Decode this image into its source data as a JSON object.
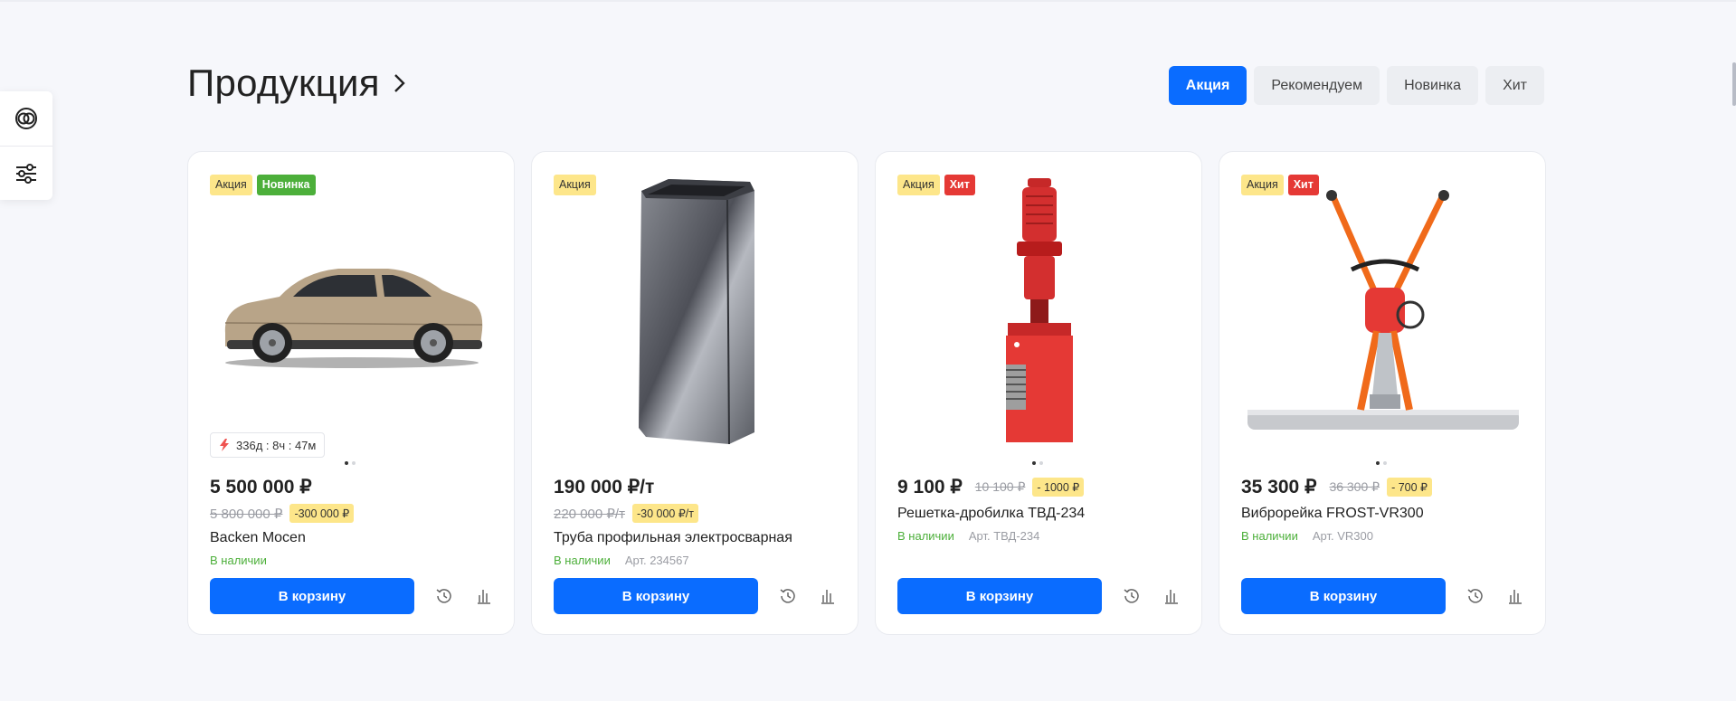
{
  "header": {
    "title": "Продукция"
  },
  "tabs": [
    {
      "label": "Акция",
      "active": true
    },
    {
      "label": "Рекомендуем",
      "active": false
    },
    {
      "label": "Новинка",
      "active": false
    },
    {
      "label": "Хит",
      "active": false
    }
  ],
  "side_panel": {
    "items": [
      "compare-circles-icon",
      "filter-sliders-icon"
    ]
  },
  "colors": {
    "accent": "#0a6cff",
    "promo_badge": "#fde68a",
    "new_badge": "#4caf3a",
    "hit_badge": "#e53935",
    "in_stock": "#4caf3a"
  },
  "products": [
    {
      "badges": [
        "Акция",
        "Новинка"
      ],
      "image": "car",
      "timer": "336д : 8ч : 47м",
      "price": "5 500 000 ₽",
      "old_price": "5 800 000 ₽",
      "discount": "-300 000 ₽",
      "name": "Backen Mocen",
      "stock": "В наличии",
      "article": "",
      "cart_label": "В корзину"
    },
    {
      "badges": [
        "Акция"
      ],
      "image": "pipe",
      "timer": "",
      "price": "190 000 ₽/т",
      "old_price": "220 000 ₽/т",
      "discount": "-30 000 ₽/т",
      "name": "Труба профильная электросварная",
      "stock": "В наличии",
      "article": "Арт. 234567",
      "cart_label": "В корзину"
    },
    {
      "badges": [
        "Акция",
        "Хит"
      ],
      "image": "crusher",
      "timer": "",
      "price": "9 100 ₽",
      "old_price": "10 100 ₽",
      "discount": "- 1000 ₽",
      "name": "Решетка-дробилка ТВД-234",
      "stock": "В наличии",
      "article": "Арт. ТВД-234",
      "cart_label": "В корзину"
    },
    {
      "badges": [
        "Акция",
        "Хит"
      ],
      "image": "vibro",
      "timer": "",
      "price": "35 300 ₽",
      "old_price": "36 300 ₽",
      "discount": "- 700 ₽",
      "name": "Виброрейка FROST-VR300",
      "stock": "В наличии",
      "article": "Арт. VR300",
      "cart_label": "В корзину"
    }
  ]
}
